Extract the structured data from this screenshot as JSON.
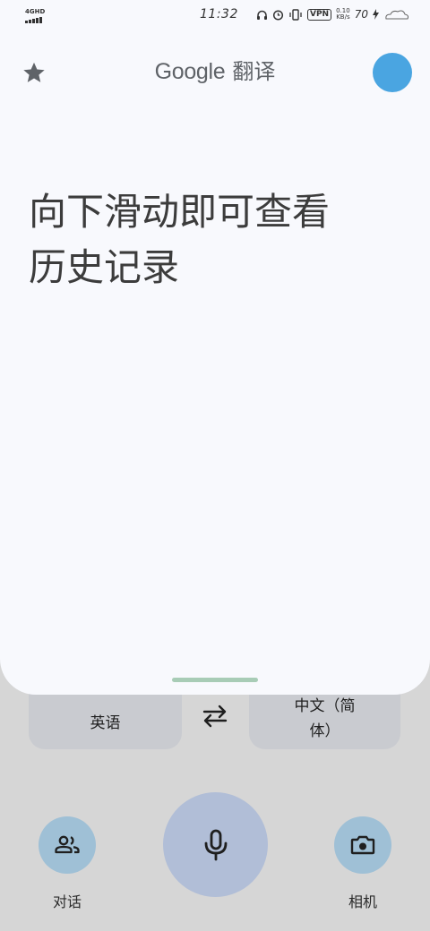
{
  "status_bar": {
    "network": "4GHD",
    "time": "11:32",
    "vpn": "VPN",
    "speed_value": "0.10",
    "speed_unit": "KB/s",
    "battery": "70"
  },
  "header": {
    "logo_word": "Google",
    "logo_suffix": "翻译",
    "star_icon": "star-icon",
    "avatar_color": "#4aa5e1"
  },
  "main": {
    "prompt_line1": "向下滑动即可查看",
    "prompt_line2": "历史记录"
  },
  "languages": {
    "source": "英语",
    "target": "中文（简体）",
    "swap_icon": "swap-arrows-icon"
  },
  "actions": {
    "conversation_label": "对话",
    "conversation_icon": "people-icon",
    "mic_icon": "microphone-icon",
    "camera_label": "相机",
    "camera_icon": "camera-icon"
  },
  "colors": {
    "card_bg": "#f8f9fd",
    "panel_bg": "#d6d6d6",
    "lang_button_bg": "#c9cbd0",
    "mic_bg": "#b1bed7",
    "side_button_bg": "#9fc0d6",
    "handle": "#a8ccb6"
  }
}
